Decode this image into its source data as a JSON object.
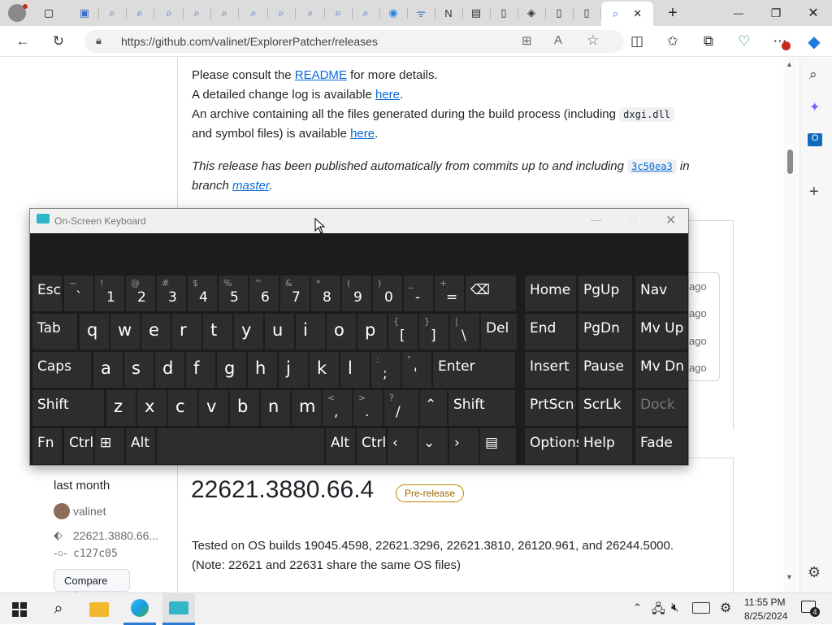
{
  "browser": {
    "url": "https://github.com/valinet/ExplorerPatcher/releases",
    "tab_close": "✕",
    "new_tab": "+",
    "window": {
      "min": "—",
      "max": "❐",
      "close": "✕"
    }
  },
  "page": {
    "readme_pre": "Please consult the ",
    "readme_link": "README",
    "readme_post": " for more details.",
    "changelog_pre": "A detailed change log is available ",
    "changelog_link": "here",
    "changelog_post": ".",
    "archive_line1_pre": "An archive containing all the files generated during the build process (including ",
    "archive_code": "dxgi.dll",
    "archive_line2_pre": "and symbol files) is available ",
    "archive_link": "here",
    "archive_post": ".",
    "auto_pre": "This release has been published automatically from commits up to and including ",
    "auto_code": "3c50ea3",
    "auto_in": " in",
    "branch_pre": "branch ",
    "branch_link": "master",
    "branch_post": ".",
    "ago_labels": [
      "ago",
      "ago",
      "ago",
      "ago"
    ],
    "release": {
      "date": "last month",
      "author": "valinet",
      "tag": "22621.3880.66...",
      "commit": "c127c05",
      "compare": "Compare",
      "title": "22621.3880.66.4",
      "badge": "Pre-release",
      "tested": "Tested on OS builds 19045.4598, 22621.3296, 22621.3810, 26120.961, and 26244.5000.",
      "note": "(Note: 22621 and 22631 share the same OS files)"
    }
  },
  "osk": {
    "title": "On-Screen Keyboard",
    "rows": [
      [
        {
          "main": "Esc",
          "label": true
        },
        {
          "main": "`",
          "sub": "~"
        },
        {
          "main": "1",
          "sub": "!"
        },
        {
          "main": "2",
          "sub": "@"
        },
        {
          "main": "3",
          "sub": "#"
        },
        {
          "main": "4",
          "sub": "$"
        },
        {
          "main": "5",
          "sub": "%"
        },
        {
          "main": "6",
          "sub": "^"
        },
        {
          "main": "7",
          "sub": "&"
        },
        {
          "main": "8",
          "sub": "*"
        },
        {
          "main": "9",
          "sub": "("
        },
        {
          "main": "0",
          "sub": ")"
        },
        {
          "main": "-",
          "sub": "_"
        },
        {
          "main": "=",
          "sub": "+"
        },
        {
          "main": "⌫",
          "label": true
        },
        {
          "main": "Home",
          "label": true
        },
        {
          "main": "PgUp",
          "label": true
        },
        {
          "main": "Nav",
          "label": true
        }
      ],
      [
        {
          "main": "Tab",
          "label": true
        },
        {
          "main": "q"
        },
        {
          "main": "w"
        },
        {
          "main": "e"
        },
        {
          "main": "r"
        },
        {
          "main": "t"
        },
        {
          "main": "y"
        },
        {
          "main": "u"
        },
        {
          "main": "i"
        },
        {
          "main": "o"
        },
        {
          "main": "p"
        },
        {
          "main": "[",
          "sub": "{"
        },
        {
          "main": "]",
          "sub": "}"
        },
        {
          "main": "\\",
          "sub": "|"
        },
        {
          "main": "Del",
          "label": true
        },
        {
          "main": "End",
          "label": true
        },
        {
          "main": "PgDn",
          "label": true
        },
        {
          "main": "Mv Up",
          "label": true
        }
      ],
      [
        {
          "main": "Caps",
          "label": true
        },
        {
          "main": "a"
        },
        {
          "main": "s"
        },
        {
          "main": "d"
        },
        {
          "main": "f"
        },
        {
          "main": "g"
        },
        {
          "main": "h"
        },
        {
          "main": "j"
        },
        {
          "main": "k"
        },
        {
          "main": "l"
        },
        {
          "main": ";",
          "sub": ":"
        },
        {
          "main": "'",
          "sub": "\""
        },
        {
          "main": "Enter",
          "label": true
        },
        {
          "main": "Insert",
          "label": true
        },
        {
          "main": "Pause",
          "label": true
        },
        {
          "main": "Mv Dn",
          "label": true
        }
      ],
      [
        {
          "main": "Shift",
          "label": true
        },
        {
          "main": "z"
        },
        {
          "main": "x"
        },
        {
          "main": "c"
        },
        {
          "main": "v"
        },
        {
          "main": "b"
        },
        {
          "main": "n"
        },
        {
          "main": "m"
        },
        {
          "main": ",",
          "sub": "<"
        },
        {
          "main": ".",
          "sub": ">"
        },
        {
          "main": "/",
          "sub": "?"
        },
        {
          "main": "⌃",
          "label": true
        },
        {
          "main": "Shift",
          "label": true
        },
        {
          "main": "PrtScn",
          "label": true
        },
        {
          "main": "ScrLk",
          "label": true
        },
        {
          "main": "Dock",
          "label": true,
          "disabled": true
        }
      ],
      [
        {
          "main": "Fn",
          "label": true
        },
        {
          "main": "Ctrl",
          "label": true
        },
        {
          "main": "⊞",
          "label": true
        },
        {
          "main": "Alt",
          "label": true
        },
        {
          "main": "",
          "label": true
        },
        {
          "main": "Alt",
          "label": true
        },
        {
          "main": "Ctrl",
          "label": true
        },
        {
          "main": "‹",
          "label": true
        },
        {
          "main": "⌄",
          "label": true
        },
        {
          "main": "›",
          "label": true
        },
        {
          "main": "▤",
          "label": true
        },
        {
          "main": "Options",
          "label": true
        },
        {
          "main": "Help",
          "label": true
        },
        {
          "main": "Fade",
          "label": true
        }
      ]
    ]
  },
  "taskbar": {
    "time": "11:55 PM",
    "date": "8/25/2024",
    "notif_count": "4"
  }
}
